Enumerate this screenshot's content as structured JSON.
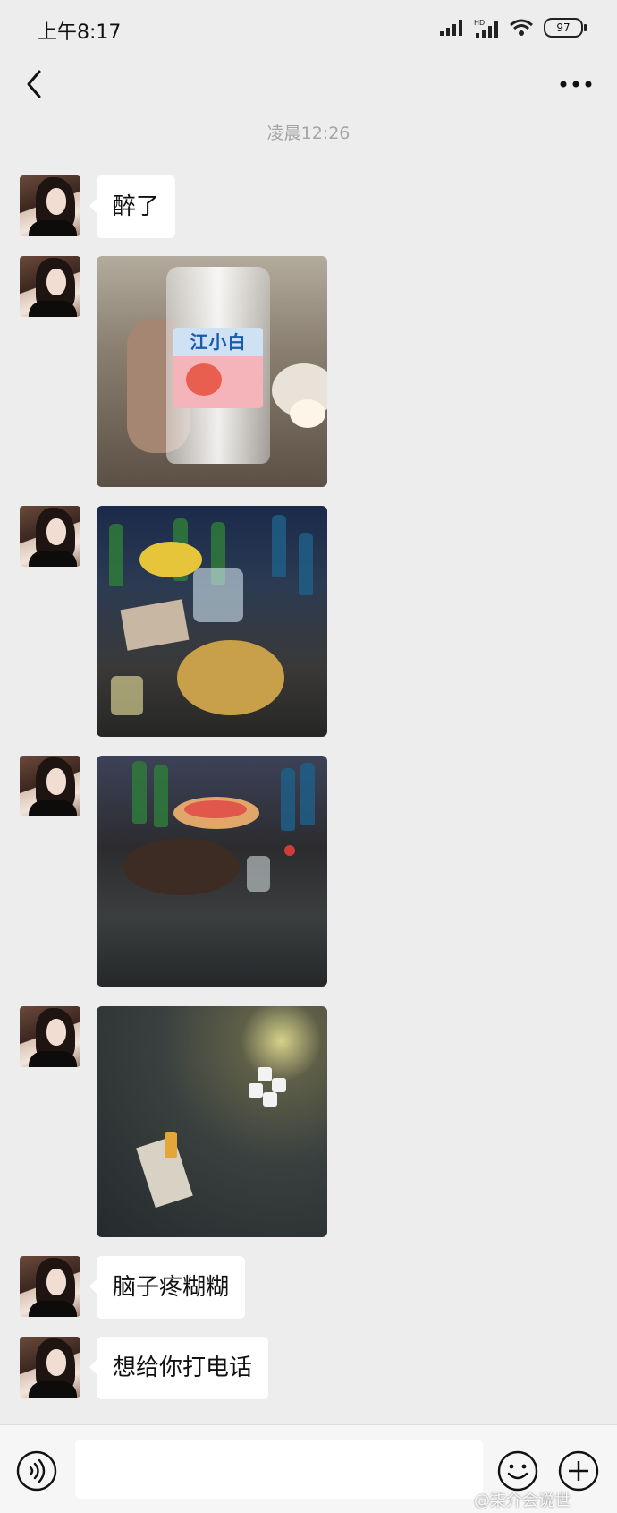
{
  "status_bar": {
    "time": "上午8:17",
    "battery": "97",
    "network_hd": "HD",
    "network_type": "4G"
  },
  "header": {
    "title": "",
    "back_icon": "chevron-left-icon",
    "more_icon": "more-horizontal-icon"
  },
  "chat": {
    "timestamp": "凌晨12:26",
    "messages": [
      {
        "type": "text",
        "text": "醉了"
      },
      {
        "type": "image",
        "description_icon": "photo-drink-bottle",
        "bottle_label": "江小白"
      },
      {
        "type": "image",
        "description_icon": "photo-table-drinks"
      },
      {
        "type": "image",
        "description_icon": "photo-fruit-plate"
      },
      {
        "type": "image",
        "description_icon": "photo-dice-table"
      },
      {
        "type": "text",
        "text": "脑子疼糊糊"
      },
      {
        "type": "text",
        "text": "想给你打电话"
      }
    ]
  },
  "input_bar": {
    "voice_icon": "voice-icon",
    "emoji_icon": "emoji-icon",
    "plus_icon": "plus-icon",
    "placeholder": ""
  },
  "watermark": {
    "text": "@柒介会说世"
  },
  "colors": {
    "background": "#ededed",
    "bubble": "#ffffff",
    "timestamp": "#a5a5a5"
  }
}
